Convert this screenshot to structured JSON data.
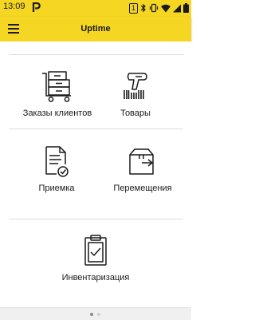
{
  "status_bar": {
    "time": "13:09",
    "notification_icon": "p-letter-icon",
    "sim_label": "1",
    "icons": [
      "bluetooth-icon",
      "vibrate-icon",
      "wifi-icon",
      "signal-icon",
      "battery-icon"
    ]
  },
  "app_bar": {
    "title": "Uptime",
    "menu_icon": "hamburger-menu-icon"
  },
  "tiles": [
    {
      "label": "Заказы клиентов",
      "icon": "cart-with-boxes-icon"
    },
    {
      "label": "Товары",
      "icon": "barcode-scanner-icon"
    },
    {
      "label": "Приемка",
      "icon": "document-check-icon"
    },
    {
      "label": "Перемещения",
      "icon": "box-transfer-icon"
    },
    {
      "label": "Инвентаризация",
      "icon": "clipboard-check-icon"
    }
  ],
  "pager": {
    "pages": 2,
    "active_index": 0
  },
  "colors": {
    "accent": "#f5d623",
    "text": "#1a1a1a",
    "divider": "#dcdcdc"
  }
}
